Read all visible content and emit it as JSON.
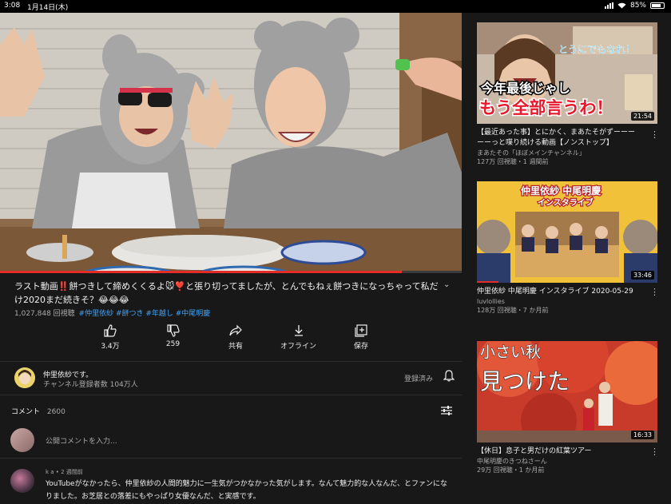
{
  "status": {
    "time": "3:08",
    "date": "1月14日(木)",
    "battery": "85%"
  },
  "player": {
    "progress": 0.87
  },
  "video": {
    "title": "ラスト動画‼️餅つきして締めくくるよ🐭❣️と張り切ってましたが、とんでもねぇ餅つきになっちゃって私だけ2020まだ続きそ？😂😂😂",
    "views": "1,027,848 回視聴",
    "tags": "#仲里依紗 #餅つき #年越し #中尾明慶"
  },
  "actions": {
    "like": "3.4万",
    "dislike": "259",
    "share": "共有",
    "offline": "オフライン",
    "save": "保存"
  },
  "channel": {
    "name": "仲里依紗です。",
    "subs": "チャンネル登録者数 104万人",
    "subscribed": "登録済み"
  },
  "comments": {
    "header": "コメント",
    "count": "2600",
    "placeholder": "公開コメントを入力...",
    "first": {
      "author_meta": "k a • 2 週間前",
      "text": "YouTubeがなかったら、仲里依紗の人間的魅力に一生気がつかなかった気がします。なんて魅力的な人なんだ、とファンになりました。お芝居との落差にもやっぱり女優なんだ、と実感です。"
    }
  },
  "recommendations": [
    {
      "overlay_small": "とうにでもなれ！",
      "overlay_line1": "今年最後じゃし",
      "overlay_line2": "もう全部言うわ！",
      "duration": "21:54",
      "title": "【最近あった事】とにかく、まあたそがずーーーーーっと喋り続ける動画【ノンストップ】",
      "channel": "まあたその「ほぼメインチャンネル」",
      "info": "127万 回視聴・1 週間前",
      "progress": 0
    },
    {
      "overlay_line1": "仲里依紗 中尾明慶",
      "overlay_line2": "インスタライブ",
      "duration": "33:46",
      "title": "仲里依紗 中尾明慶 インスタライブ 2020-05-29",
      "channel": "luvlollies",
      "info": "128万 回視聴・7 か月前",
      "progress": 0.12
    },
    {
      "overlay_line1": "小さい秋",
      "overlay_line2": "見つけた",
      "duration": "16:33",
      "title": "【休日】息子と男だけの紅葉ツアー",
      "channel": "中尾明慶のきつねさーん",
      "info": "29万 回視聴・1 か月前",
      "progress": 0
    }
  ]
}
